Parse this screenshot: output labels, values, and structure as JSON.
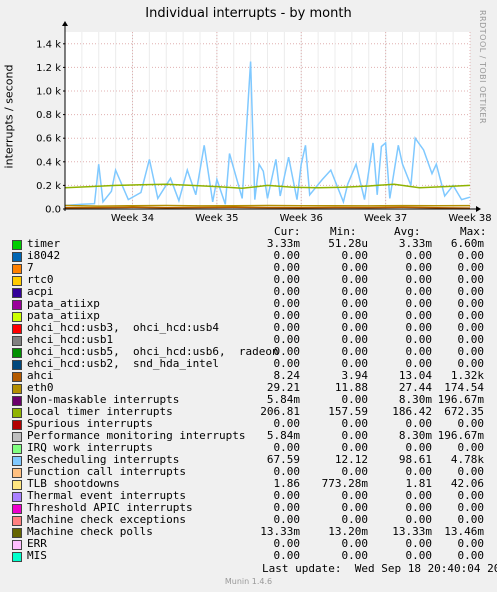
{
  "title": "Individual interrupts - by month",
  "watermark": "RRDTOOL / TOBI OETIKER",
  "last_update": "Last update:  Wed Sep 18 20:40:04 2024",
  "footer": "Munin 1.4.6",
  "legend": {
    "headers": [
      "Cur:",
      "Min:",
      "Avg:",
      "Max:"
    ],
    "rows": [
      {
        "name": "timer",
        "color": "#00cc00",
        "cur": "3.33m",
        "min": "51.28u",
        "avg": "3.33m",
        "max": "6.60m"
      },
      {
        "name": "i8042",
        "color": "#0066b3",
        "cur": "0.00",
        "min": "0.00",
        "avg": "0.00",
        "max": "0.00"
      },
      {
        "name": "7",
        "color": "#ff8000",
        "cur": "0.00",
        "min": "0.00",
        "avg": "0.00",
        "max": "0.00"
      },
      {
        "name": "rtc0",
        "color": "#ffcc00",
        "cur": "0.00",
        "min": "0.00",
        "avg": "0.00",
        "max": "0.00"
      },
      {
        "name": "acpi",
        "color": "#330099",
        "cur": "0.00",
        "min": "0.00",
        "avg": "0.00",
        "max": "0.00"
      },
      {
        "name": "pata_atiixp",
        "color": "#990099",
        "cur": "0.00",
        "min": "0.00",
        "avg": "0.00",
        "max": "0.00"
      },
      {
        "name": "pata_atiixp",
        "color": "#ccff00",
        "cur": "0.00",
        "min": "0.00",
        "avg": "0.00",
        "max": "0.00"
      },
      {
        "name": "ohci_hcd:usb3,  ohci_hcd:usb4",
        "color": "#ff0000",
        "cur": "0.00",
        "min": "0.00",
        "avg": "0.00",
        "max": "0.00"
      },
      {
        "name": "ehci_hcd:usb1",
        "color": "#808080",
        "cur": "0.00",
        "min": "0.00",
        "avg": "0.00",
        "max": "0.00"
      },
      {
        "name": "ohci_hcd:usb5,  ohci_hcd:usb6,  radeon",
        "color": "#008f00",
        "cur": "0.00",
        "min": "0.00",
        "avg": "0.00",
        "max": "0.00"
      },
      {
        "name": "ehci_hcd:usb2,  snd_hda_intel",
        "color": "#00487d",
        "cur": "0.00",
        "min": "0.00",
        "avg": "0.00",
        "max": "0.00"
      },
      {
        "name": "ahci",
        "color": "#b35a00",
        "cur": "8.24",
        "min": "3.94",
        "avg": "13.04",
        "max": "1.32k"
      },
      {
        "name": "eth0",
        "color": "#b38f00",
        "cur": "29.21",
        "min": "11.88",
        "avg": "27.44",
        "max": "174.54"
      },
      {
        "name": "Non-maskable interrupts",
        "color": "#6b006b",
        "cur": "5.84m",
        "min": "0.00",
        "avg": "8.30m",
        "max": "196.67m"
      },
      {
        "name": "Local timer interrupts",
        "color": "#8fb300",
        "cur": "206.81",
        "min": "157.59",
        "avg": "186.42",
        "max": "672.35"
      },
      {
        "name": "Spurious interrupts",
        "color": "#b30000",
        "cur": "0.00",
        "min": "0.00",
        "avg": "0.00",
        "max": "0.00"
      },
      {
        "name": "Performance monitoring interrupts",
        "color": "#bebebe",
        "cur": "5.84m",
        "min": "0.00",
        "avg": "8.30m",
        "max": "196.67m"
      },
      {
        "name": "IRQ work interrupts",
        "color": "#80ff80",
        "cur": "0.00",
        "min": "0.00",
        "avg": "0.00",
        "max": "0.00"
      },
      {
        "name": "Rescheduling interrupts",
        "color": "#80c9ff",
        "cur": "67.59",
        "min": "12.12",
        "avg": "98.61",
        "max": "4.78k"
      },
      {
        "name": "Function call interrupts",
        "color": "#ffc080",
        "cur": "0.00",
        "min": "0.00",
        "avg": "0.00",
        "max": "0.00"
      },
      {
        "name": "TLB shootdowns",
        "color": "#ffe680",
        "cur": "1.86",
        "min": "773.28m",
        "avg": "1.81",
        "max": "42.06"
      },
      {
        "name": "Thermal event interrupts",
        "color": "#aa80ff",
        "cur": "0.00",
        "min": "0.00",
        "avg": "0.00",
        "max": "0.00"
      },
      {
        "name": "Threshold APIC interrupts",
        "color": "#ee00cc",
        "cur": "0.00",
        "min": "0.00",
        "avg": "0.00",
        "max": "0.00"
      },
      {
        "name": "Machine check exceptions",
        "color": "#ff8080",
        "cur": "0.00",
        "min": "0.00",
        "avg": "0.00",
        "max": "0.00"
      },
      {
        "name": "Machine check polls",
        "color": "#666600",
        "cur": "13.33m",
        "min": "13.20m",
        "avg": "13.33m",
        "max": "13.46m"
      },
      {
        "name": "ERR",
        "color": "#ffbfff",
        "cur": "0.00",
        "min": "0.00",
        "avg": "0.00",
        "max": "0.00"
      },
      {
        "name": "MIS",
        "color": "#00ffcc",
        "cur": "0.00",
        "min": "0.00",
        "avg": "0.00",
        "max": "0.00"
      }
    ]
  },
  "chart_data": {
    "type": "line",
    "title": "Individual interrupts - by month",
    "ylabel": "interrupts / second",
    "xlabel": "",
    "ylim": [
      0,
      1500
    ],
    "yticks": [
      0,
      200,
      400,
      600,
      800,
      1000,
      1200,
      1400
    ],
    "ytick_labels": [
      "0.0",
      "0.2 k",
      "0.4 k",
      "0.6 k",
      "0.8 k",
      "1.0 k",
      "1.2 k",
      "1.4 k"
    ],
    "xlim": [
      33.2,
      38.0
    ],
    "xticks": [
      34,
      35,
      36,
      37,
      38
    ],
    "xtick_labels": [
      "Week 34",
      "Week 35",
      "Week 36",
      "Week 37",
      "Week 38"
    ],
    "grid": true,
    "series": [
      {
        "name": "Rescheduling interrupts",
        "color": "#80c9ff",
        "x": [
          33.2,
          33.4,
          33.55,
          33.6,
          33.65,
          33.75,
          33.8,
          33.95,
          34.1,
          34.2,
          34.3,
          34.45,
          34.55,
          34.65,
          34.75,
          34.85,
          34.95,
          35.0,
          35.1,
          35.15,
          35.3,
          35.4,
          35.45,
          35.5,
          35.55,
          35.6,
          35.7,
          35.75,
          35.85,
          35.95,
          36.0,
          36.05,
          36.1,
          36.25,
          36.35,
          36.5,
          36.55,
          36.65,
          36.75,
          36.85,
          36.9,
          36.95,
          37.0,
          37.05,
          37.15,
          37.2,
          37.3,
          37.35,
          37.45,
          37.55,
          37.6,
          37.7,
          37.8,
          37.9,
          38.0
        ],
        "values": [
          30,
          40,
          45,
          380,
          60,
          150,
          330,
          80,
          140,
          420,
          90,
          260,
          70,
          330,
          120,
          540,
          60,
          250,
          40,
          470,
          90,
          1250,
          80,
          380,
          320,
          90,
          420,
          110,
          440,
          80,
          380,
          540,
          120,
          250,
          330,
          60,
          210,
          380,
          80,
          560,
          120,
          530,
          560,
          90,
          540,
          380,
          200,
          600,
          500,
          300,
          380,
          110,
          200,
          80,
          100
        ]
      },
      {
        "name": "Local timer interrupts",
        "color": "#8fb300",
        "x": [
          33.2,
          33.5,
          33.8,
          34.1,
          34.4,
          34.7,
          35.0,
          35.3,
          35.6,
          35.9,
          36.2,
          36.5,
          36.8,
          37.1,
          37.4,
          37.7,
          38.0
        ],
        "values": [
          180,
          190,
          200,
          205,
          210,
          200,
          190,
          175,
          200,
          185,
          180,
          185,
          195,
          210,
          180,
          190,
          200
        ]
      },
      {
        "name": "eth0",
        "color": "#b38f00",
        "x": [
          33.2,
          33.6,
          34.0,
          34.4,
          34.8,
          35.2,
          35.6,
          36.0,
          36.4,
          36.8,
          37.2,
          37.6,
          38.0
        ],
        "values": [
          30,
          25,
          28,
          30,
          26,
          28,
          30,
          27,
          28,
          26,
          29,
          27,
          29
        ]
      },
      {
        "name": "ahci",
        "color": "#b35a00",
        "x": [
          33.2,
          33.6,
          34.0,
          34.4,
          34.8,
          35.2,
          35.6,
          36.0,
          36.4,
          36.8,
          37.2,
          37.6,
          38.0
        ],
        "values": [
          10,
          12,
          14,
          11,
          13,
          15,
          12,
          10,
          13,
          12,
          14,
          11,
          8
        ]
      }
    ]
  }
}
